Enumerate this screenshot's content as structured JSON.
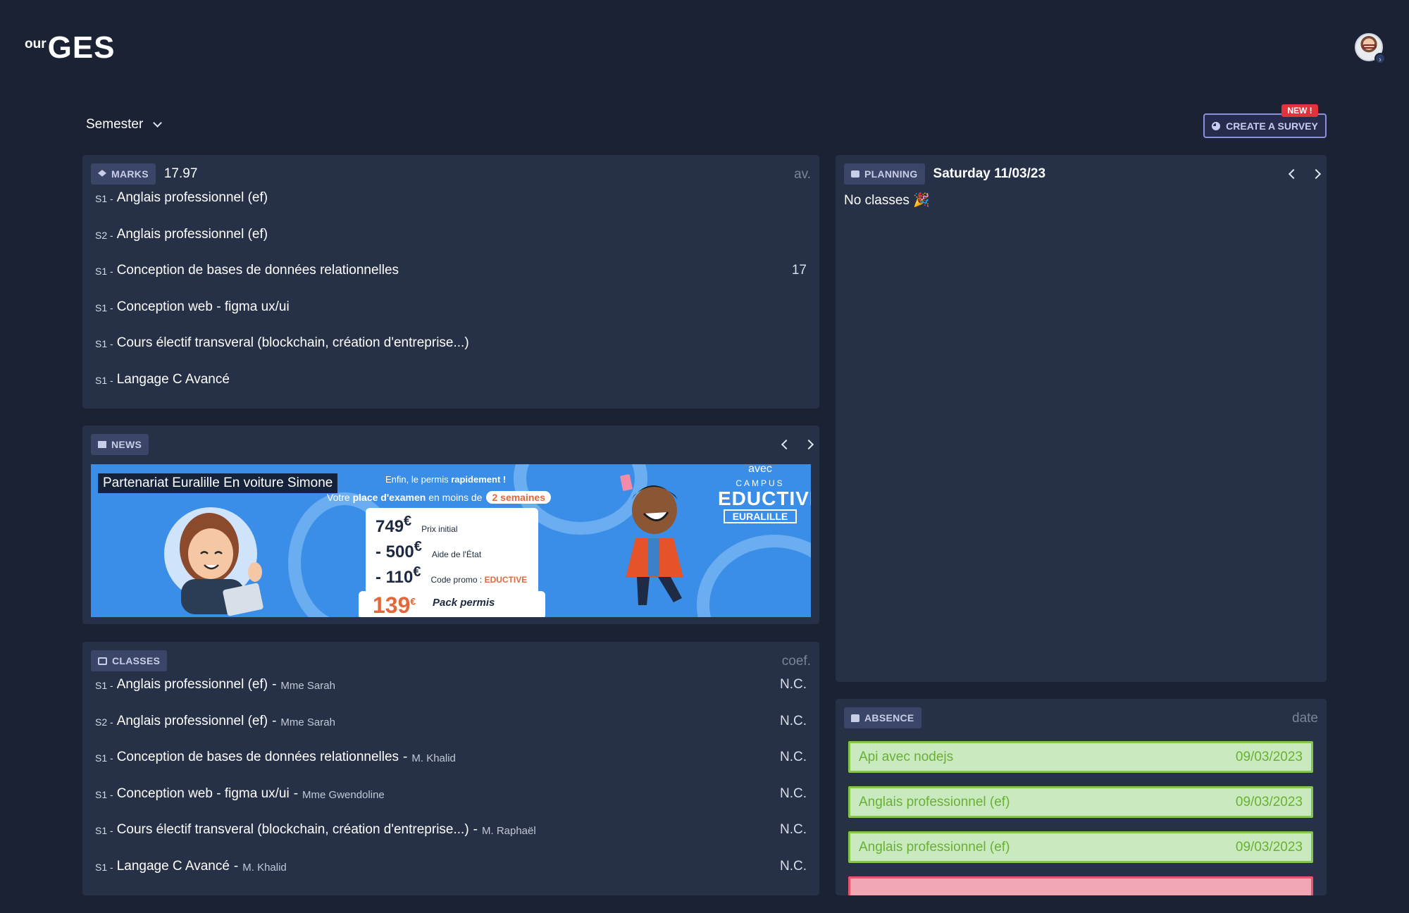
{
  "header": {
    "logo_prefix": "our",
    "logo_main": "GES"
  },
  "semester": {
    "label": "Semester"
  },
  "survey": {
    "label": "CREATE A SURVEY",
    "badge": "NEW !"
  },
  "marks": {
    "tag": "MARKS",
    "average": "17.97",
    "column_label": "av.",
    "rows": [
      {
        "sem": "S1 -",
        "name": "Anglais professionnel (ef)",
        "value": ""
      },
      {
        "sem": "S2 -",
        "name": "Anglais professionnel (ef)",
        "value": ""
      },
      {
        "sem": "S1 -",
        "name": "Conception de bases de données relationnelles",
        "value": "17"
      },
      {
        "sem": "S1 -",
        "name": "Conception web - figma ux/ui",
        "value": ""
      },
      {
        "sem": "S1 -",
        "name": "Cours électif transveral (blockchain, création d'entreprise...)",
        "value": ""
      },
      {
        "sem": "S1 -",
        "name": "Langage C Avancé",
        "value": ""
      }
    ]
  },
  "news": {
    "tag": "NEWS",
    "item_title": "Partenariat Euralille En voiture Simone",
    "banner": {
      "headline_a": "Enfin, le permis ",
      "headline_b": "rapidement !",
      "sub_a": "Votre ",
      "sub_b": "place d'examen",
      "sub_c": " en moins de",
      "sub_pill": "2 semaines",
      "price1_num": "749",
      "price1_cur": "€",
      "price1_label": "Prix initial",
      "price2_num": "- 500",
      "price2_cur": "€",
      "price2_label": "Aide de l'État",
      "price3_num": "- 110",
      "price3_cur": "€",
      "price3_label_a": "Code promo : ",
      "price3_label_b": "EDUCTIVE",
      "pack_num": "139",
      "pack_cur": "€",
      "pack_label": "Pack permis",
      "ed_avec": "avec",
      "ed_campus": "CAMPUS",
      "ed_main": "EDUCTIVE",
      "ed_city": "EURALILLE"
    }
  },
  "classes": {
    "tag": "CLASSES",
    "column_label": "coef.",
    "rows": [
      {
        "sem": "S1 -",
        "name": "Anglais professionnel (ef)",
        "teacher": "Mme Sarah",
        "coef": "N.C."
      },
      {
        "sem": "S2 -",
        "name": "Anglais professionnel (ef)",
        "teacher": "Mme Sarah",
        "coef": "N.C."
      },
      {
        "sem": "S1 -",
        "name": "Conception de bases de données relationnelles",
        "teacher": "M. Khalid",
        "coef": "N.C."
      },
      {
        "sem": "S1 -",
        "name": "Conception web - figma ux/ui",
        "teacher": "Mme Gwendoline",
        "coef": "N.C."
      },
      {
        "sem": "S1 -",
        "name": "Cours électif transveral (blockchain, création d'entreprise...)",
        "teacher": "M. Raphaël",
        "coef": "N.C."
      },
      {
        "sem": "S1 -",
        "name": "Langage C Avancé",
        "teacher": "M. Khalid",
        "coef": "N.C."
      }
    ]
  },
  "planning": {
    "tag": "PLANNING",
    "date": "Saturday 11/03/23",
    "empty_text": "No classes 🎉"
  },
  "absence": {
    "tag": "ABSENCE",
    "column_label": "date",
    "items": [
      {
        "name": "Api avec nodejs",
        "date": "09/03/2023"
      },
      {
        "name": "Anglais professionnel (ef)",
        "date": "09/03/2023"
      },
      {
        "name": "Anglais professionnel (ef)",
        "date": "09/03/2023"
      }
    ]
  },
  "colors": {
    "background": "#1b2233",
    "card": "#263147",
    "tag_bg": "#3b4568",
    "absence_ok_border": "#84c648",
    "absence_ok_bg": "#c9e9be",
    "absence_late": "#e9546c",
    "new_badge": "#e2323c"
  }
}
